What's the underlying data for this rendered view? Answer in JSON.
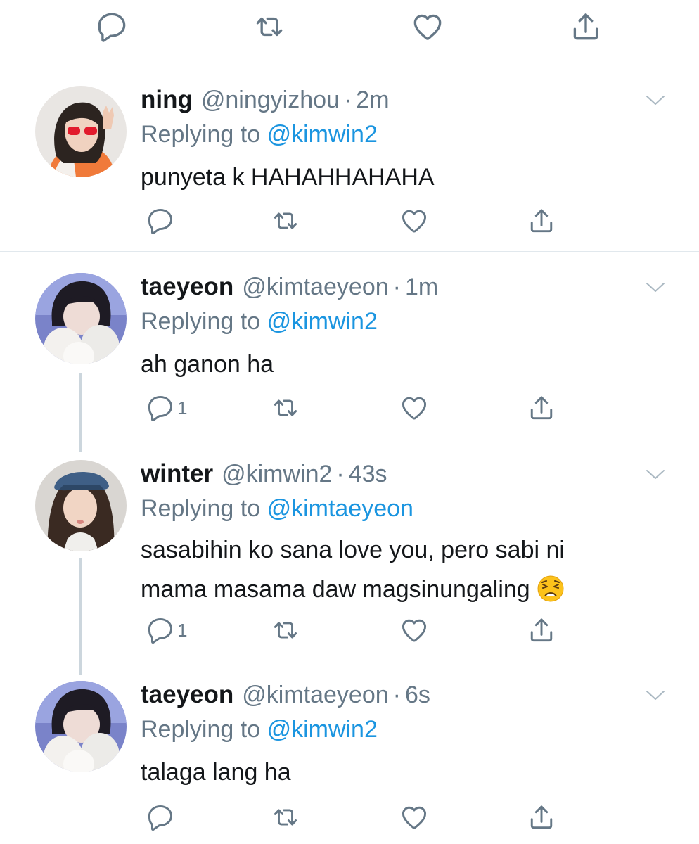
{
  "top_actions": {
    "reply_icon": "reply-icon",
    "retweet_icon": "retweet-icon",
    "like_icon": "heart-icon",
    "share_icon": "share-icon"
  },
  "tweets": [
    {
      "name": "ning",
      "handle": "@ningyizhou",
      "sep": "·",
      "time": "2m",
      "replying_prefix": "Replying to",
      "replying_to": "@kimwin2",
      "text": "punyeta k HAHAHHAHAHA",
      "reply_count": ""
    },
    {
      "name": "taeyeon",
      "handle": "@kimtaeyeon",
      "sep": "·",
      "time": "1m",
      "replying_prefix": "Replying to",
      "replying_to": "@kimwin2",
      "text": "ah ganon ha",
      "reply_count": "1"
    },
    {
      "name": "winter",
      "handle": "@kimwin2",
      "sep": "·",
      "time": "43s",
      "replying_prefix": "Replying to",
      "replying_to": "@kimtaeyeon",
      "text_line1": "sasabihin ko sana love you, pero sabi ni",
      "text_line2": "mama masama daw magsinungaling",
      "emoji": "weary-face-emoji",
      "reply_count": "1"
    },
    {
      "name": "taeyeon",
      "handle": "@kimtaeyeon",
      "sep": "·",
      "time": "6s",
      "replying_prefix": "Replying to",
      "replying_to": "@kimwin2",
      "text": "talaga lang ha",
      "reply_count": ""
    }
  ],
  "colors": {
    "text": "#14171a",
    "secondary": "#657786",
    "link": "#1b95e0",
    "divider": "#e1e8ed",
    "thread_line": "#ccd6dd"
  }
}
